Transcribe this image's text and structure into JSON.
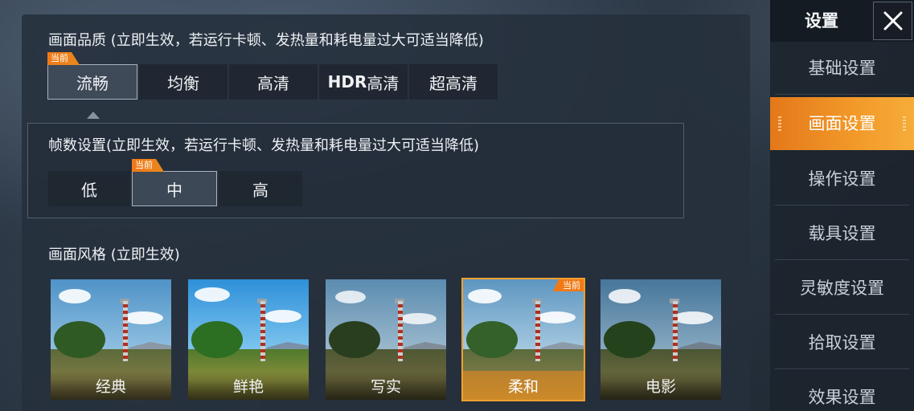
{
  "quality": {
    "title": "画面品质 (立即生效，若运行卡顿、发热量和耗电量过大可适当降低)",
    "current_tag": "当前",
    "options": [
      {
        "label": "流畅",
        "active": true
      },
      {
        "label": "均衡",
        "active": false
      },
      {
        "label": "高清",
        "active": false
      },
      {
        "label_bold": "HDR",
        "label": "高清",
        "active": false
      },
      {
        "label": "超高清",
        "active": false
      }
    ]
  },
  "fps": {
    "title": "帧数设置(立即生效，若运行卡顿、发热量和耗电量过大可适当降低)",
    "current_tag": "当前",
    "options": [
      {
        "label": "低",
        "active": false
      },
      {
        "label": "中",
        "active": true
      },
      {
        "label": "高",
        "active": false
      }
    ]
  },
  "style": {
    "title": "画面风格 (立即生效)",
    "current_tag": "当前",
    "options": [
      {
        "label": "经典",
        "active": false
      },
      {
        "label": "鲜艳",
        "active": false
      },
      {
        "label": "写实",
        "active": false
      },
      {
        "label": "柔和",
        "active": true
      },
      {
        "label": "电影",
        "active": false
      }
    ]
  },
  "sidebar": {
    "title": "设置",
    "close_icon": "close-icon",
    "items": [
      {
        "label": "基础设置",
        "active": false
      },
      {
        "label": "画面设置",
        "active": true
      },
      {
        "label": "操作设置",
        "active": false
      },
      {
        "label": "载具设置",
        "active": false
      },
      {
        "label": "灵敏度设置",
        "active": false
      },
      {
        "label": "拾取设置",
        "active": false
      },
      {
        "label": "效果设置",
        "active": false
      }
    ]
  },
  "colors": {
    "accent": "#f0881e",
    "panel": "#26303c"
  }
}
